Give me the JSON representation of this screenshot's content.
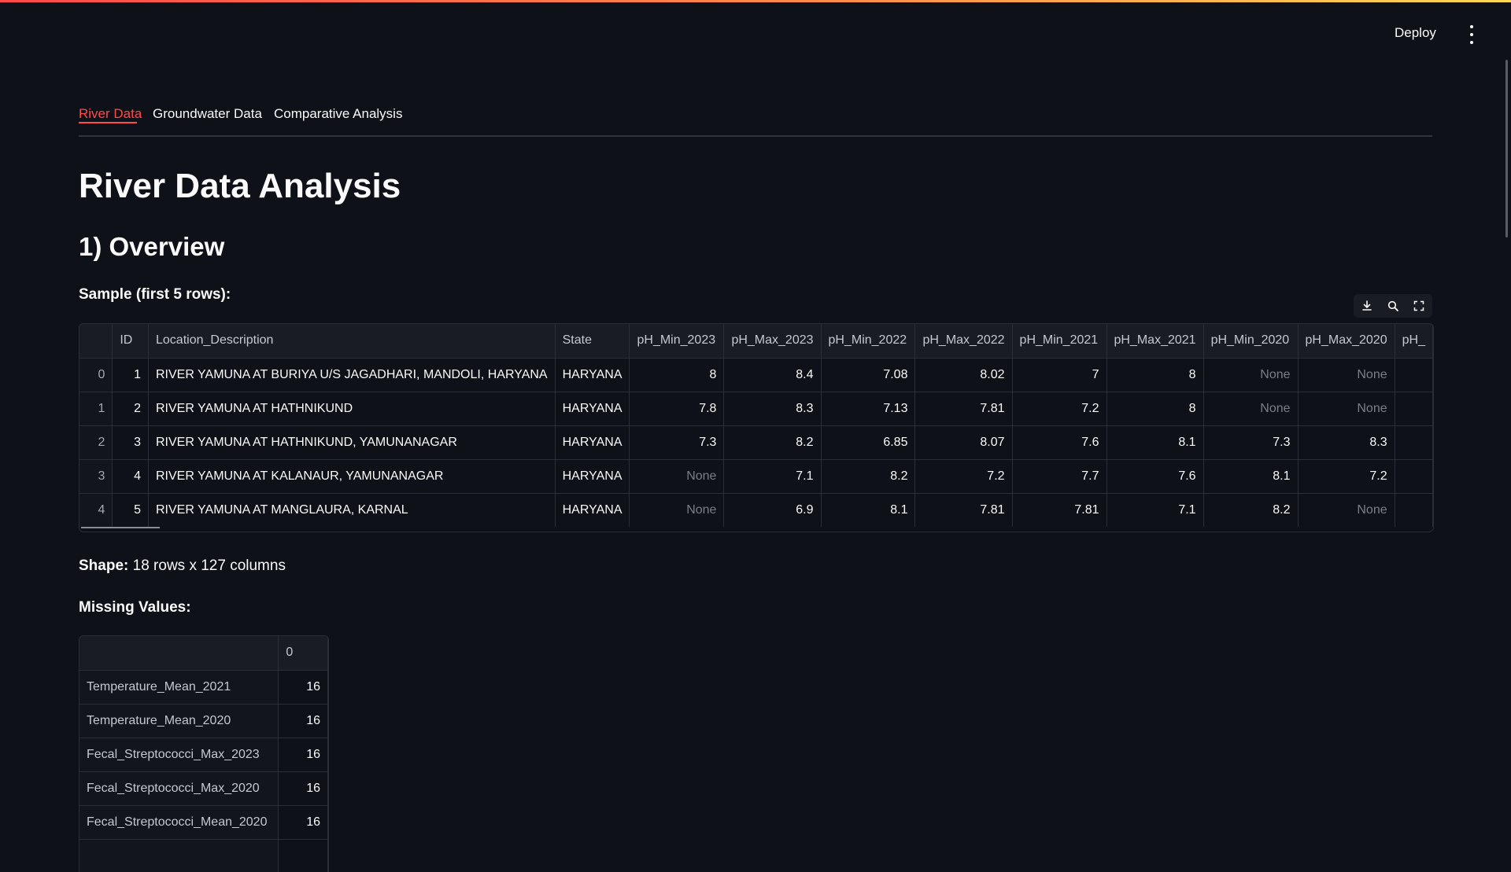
{
  "header": {
    "deploy_label": "Deploy",
    "menu_icon": "more-vertical-icon"
  },
  "tabs": [
    {
      "label": "River Data",
      "active": true
    },
    {
      "label": "Groundwater Data",
      "active": false
    },
    {
      "label": "Comparative Analysis",
      "active": false
    }
  ],
  "page": {
    "title": "River Data Analysis",
    "section_title": "1) Overview",
    "sample_label": "Sample (first 5 rows):",
    "shape_label": "Shape:",
    "shape_value": " 18 rows x 127 columns",
    "missing_label": "Missing Values:"
  },
  "toolbar": {
    "icons": [
      "download-icon",
      "search-icon",
      "fullscreen-icon"
    ]
  },
  "sample_table": {
    "columns": [
      "",
      "ID",
      "Location_Description",
      "State",
      "pH_Min_2023",
      "pH_Max_2023",
      "pH_Min_2022",
      "pH_Max_2022",
      "pH_Min_2021",
      "pH_Max_2021",
      "pH_Min_2020",
      "pH_Max_2020",
      "pH_"
    ],
    "rows": [
      [
        "0",
        "1",
        "RIVER YAMUNA AT BURIYA U/S JAGADHARI, MANDOLI, HARYANA",
        "HARYANA",
        "8",
        "8.4",
        "7.08",
        "8.02",
        "7",
        "8",
        "None",
        "None",
        ""
      ],
      [
        "1",
        "2",
        "RIVER YAMUNA AT HATHNIKUND",
        "HARYANA",
        "7.8",
        "8.3",
        "7.13",
        "7.81",
        "7.2",
        "8",
        "None",
        "None",
        ""
      ],
      [
        "2",
        "3",
        "RIVER YAMUNA AT HATHNIKUND, YAMUNANAGAR",
        "HARYANA",
        "7.3",
        "8.2",
        "6.85",
        "8.07",
        "7.6",
        "8.1",
        "7.3",
        "8.3",
        ""
      ],
      [
        "3",
        "4",
        "RIVER YAMUNA AT KALANAUR,  YAMUNANAGAR",
        "HARYANA",
        "None",
        "7.1",
        "8.2",
        "7.2",
        "7.7",
        "7.6",
        "8.1",
        "7.2",
        ""
      ],
      [
        "4",
        "5",
        "RIVER YAMUNA AT MANGLAURA, KARNAL",
        "HARYANA",
        "None",
        "6.9",
        "8.1",
        "7.81",
        "7.81",
        "7.1",
        "8.2",
        "None",
        ""
      ]
    ]
  },
  "missing_table": {
    "columns": [
      "",
      "0"
    ],
    "rows": [
      [
        "Temperature_Mean_2021",
        "16"
      ],
      [
        "Temperature_Mean_2020",
        "16"
      ],
      [
        "Fecal_Streptococci_Max_2023",
        "16"
      ],
      [
        "Fecal_Streptococci_Max_2020",
        "16"
      ],
      [
        "Fecal_Streptococci_Mean_2020",
        "16"
      ],
      [
        "",
        ""
      ]
    ]
  }
}
